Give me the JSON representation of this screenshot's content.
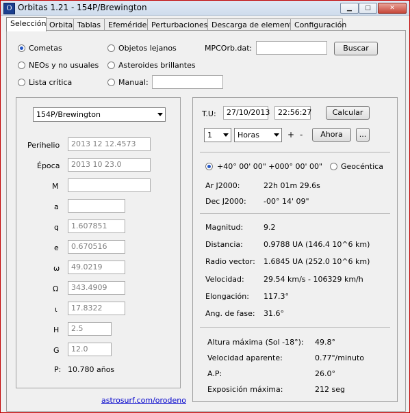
{
  "window": {
    "title": "Orbitas 1.21 - 154P/Brewington",
    "minimize": "▁",
    "maximize": "□",
    "close": "✕",
    "icon_letter": "O"
  },
  "tabs": [
    "Selección",
    "Orbita",
    "Tablas",
    "Efemérides",
    "Perturbaciones",
    "Descarga de elementos",
    "Configuración"
  ],
  "selection": {
    "opt_cometas": "Cometas",
    "opt_neos": "NEOs y no usuales",
    "opt_lista": "Lista crítica",
    "opt_lejanos": "Objetos lejanos",
    "opt_brillantes": "Asteroides brillantes",
    "opt_manual": "Manual:",
    "mpcorb_label": "MPCOrb.dat:",
    "buscar": "Buscar"
  },
  "elements": {
    "object": "154P/Brewington",
    "perihelio_label": "Perihelio",
    "perihelio": "2013 12 12.4573",
    "epoca_label": "Época",
    "epoca": "2013 10 23.0",
    "M_label": "M",
    "M": "",
    "a_label": "a",
    "a": "",
    "q_label": "q",
    "q": "1.607851",
    "e_label": "e",
    "e": "0.670516",
    "omega_label": "ω",
    "omega": "49.0219",
    "Omega_label": "Ω",
    "Omega": "343.4909",
    "i_label": "ι",
    "i": "17.8322",
    "H_label": "H",
    "H": "2.5",
    "G_label": "G",
    "G": "12.0",
    "P_label": "P:",
    "P": "10.780 años"
  },
  "link": "astrosurf.com/orodeno",
  "ephem": {
    "tu_label": "T.U:",
    "date": "27/10/2013",
    "time": "22:56:27",
    "calcular": "Calcular",
    "step": "1",
    "unit": "Horas",
    "plus": "+",
    "minus": "-",
    "ahora": "Ahora",
    "more": "...",
    "coords": "+40° 00' 00\"   +000° 00' 00\"",
    "geocentrica": "Geocéntica",
    "ar_label": "Ar J2000:",
    "ar": "22h 01m 29.6s",
    "dec_label": "Dec J2000:",
    "dec": "-00° 14' 09\"",
    "mag_label": "Magnitud:",
    "mag": "9.2",
    "dist_label": "Distancia:",
    "dist": "0.9788 UA  (146.4  10^6 km)",
    "rv_label": "Radio vector:",
    "rv": "1.6845 UA  (252.0  10^6 km)",
    "vel_label": "Velocidad:",
    "vel": "29.54  km/s  -  106329  km/h",
    "elong_label": "Elongación:",
    "elong": "117.3°",
    "fase_label": "Ang. de fase:",
    "fase": "31.6°",
    "alt_label": "Altura máxima (Sol -18°):",
    "alt": "49.8°",
    "velap_label": "Velocidad aparente:",
    "velap": "0.77\"/minuto",
    "ap_label": "A.P:",
    "ap": "26.0°",
    "exp_label": "Exposición máxima:",
    "exp": "212 seg"
  }
}
